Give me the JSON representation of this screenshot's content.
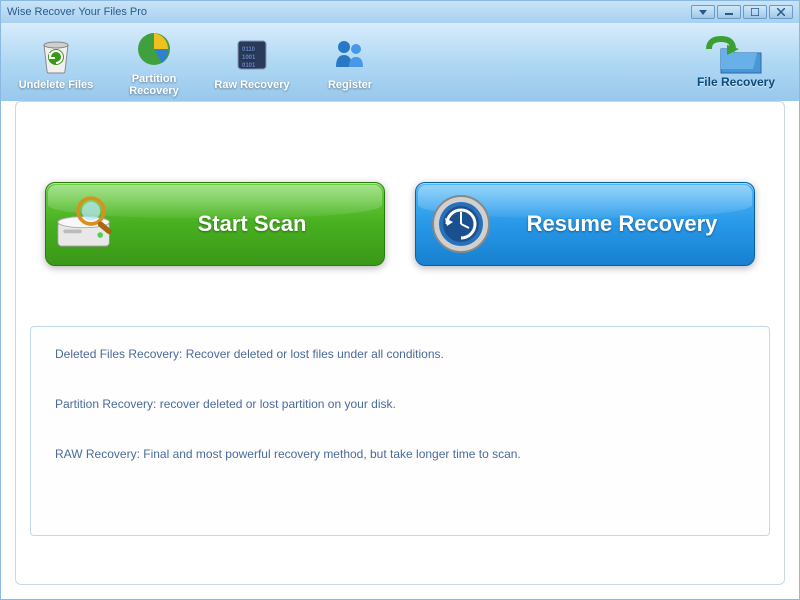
{
  "window": {
    "title": "Wise Recover Your Files Pro"
  },
  "toolbar": {
    "undelete": "Undelete Files",
    "partition": "Partition Recovery",
    "raw": "Raw Recovery",
    "register": "Register",
    "logo_arrow": "→",
    "logo_text": "File Recovery"
  },
  "main": {
    "start_scan": "Start  Scan",
    "resume_recovery": "Resume Recovery"
  },
  "info": {
    "line1": "Deleted Files Recovery: Recover deleted or lost files  under all conditions.",
    "line2": "Partition Recovery: recover deleted or lost partition on your disk.",
    "line3": "RAW Recovery: Final and most powerful recovery method, but take longer time to scan."
  }
}
